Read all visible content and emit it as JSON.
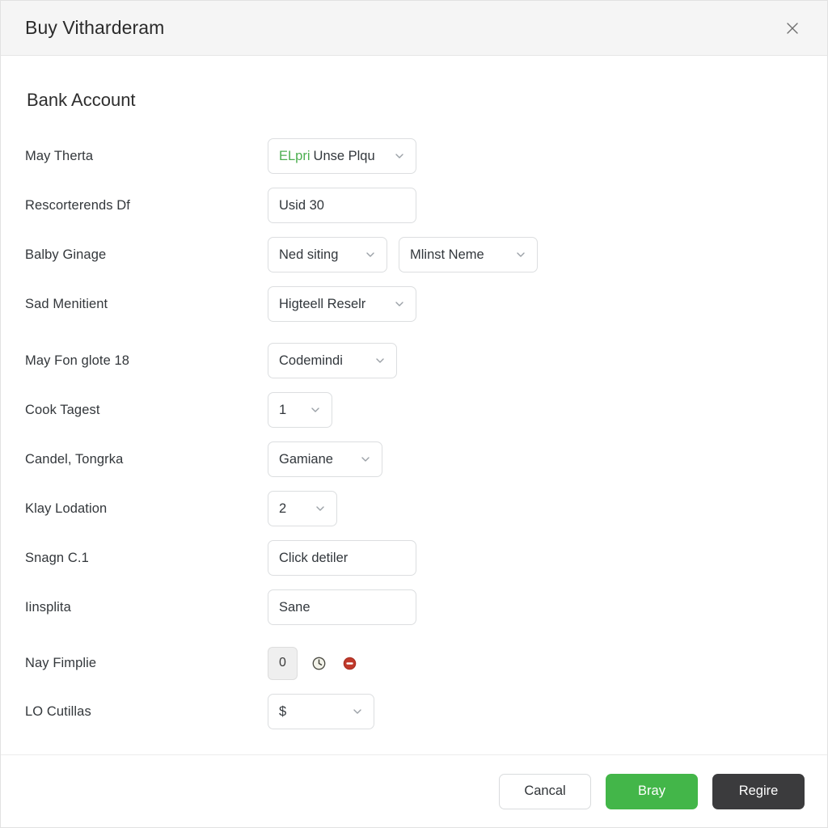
{
  "header": {
    "title": "Buy Vitharderam",
    "close_icon": "close-icon"
  },
  "body": {
    "section_title": "Bank Account",
    "rows": [
      {
        "label": "May Therta",
        "control": "select",
        "value_prefix": "ELpri",
        "value": "Unse Plqu"
      },
      {
        "label": "Rescorterends Df",
        "control": "text",
        "value": "Usid 30"
      },
      {
        "label": "Balby Ginage",
        "control": "select-pair",
        "value": "Ned siting",
        "value2": "Mlinst Neme"
      },
      {
        "label": "Sad Menitient",
        "control": "select",
        "value": "Higteell Reselr"
      },
      {
        "label": "May Fon glote 18",
        "control": "select",
        "value": "Codemindi"
      },
      {
        "label": "Cook Tagest",
        "control": "select",
        "value": "1"
      },
      {
        "label": "Candel, Tongrka",
        "control": "select",
        "value": "Gamiane"
      },
      {
        "label": "Klay Lodation",
        "control": "select",
        "value": "2"
      },
      {
        "label": "Snagn C.1",
        "control": "text",
        "value": "Click detiler"
      },
      {
        "label": "Iinsplita",
        "control": "text",
        "value": "Sane"
      },
      {
        "label": "Nay Fimplie",
        "control": "stepper",
        "value": "0",
        "icon1": "clock-icon",
        "icon2": "block-icon"
      },
      {
        "label": "LO Cutillas",
        "control": "select",
        "value": "$"
      }
    ]
  },
  "footer": {
    "cancel_label": "Cancal",
    "primary_label": "Bray",
    "secondary_label": "Regire"
  },
  "colors": {
    "accent_green": "#43b649",
    "dark_button": "#3b3b3d",
    "header_bg": "#f5f5f5",
    "prefix_green": "#4caf50",
    "block_icon_red": "#c0392b"
  }
}
